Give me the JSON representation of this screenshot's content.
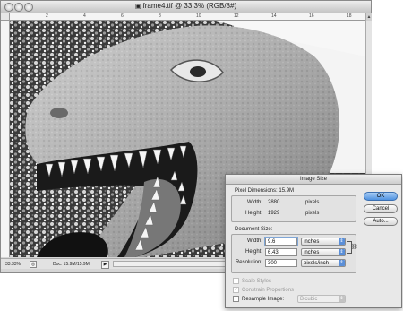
{
  "window": {
    "title": "frame4.tif @ 33.3% (RGB/8#)",
    "ruler_ticks": [
      "2",
      "4",
      "6",
      "8",
      "10",
      "12",
      "14",
      "16",
      "18"
    ]
  },
  "status": {
    "zoom": "33.33%",
    "doc_info": "Doc: 15.9M/15.9M"
  },
  "dialog": {
    "title": "Image Size",
    "pixel_dimensions": {
      "legend": "Pixel Dimensions:",
      "total": "15.9M",
      "width_label": "Width:",
      "width_value": "2880",
      "width_unit": "pixels",
      "height_label": "Height:",
      "height_value": "1929",
      "height_unit": "pixels"
    },
    "document_size": {
      "legend": "Document Size:",
      "width_label": "Width:",
      "width_value": "9.6",
      "width_unit": "inches",
      "height_label": "Height:",
      "height_value": "6.43",
      "height_unit": "inches",
      "resolution_label": "Resolution:",
      "resolution_value": "300",
      "resolution_unit": "pixels/inch"
    },
    "options": {
      "scale_styles": "Scale Styles",
      "constrain": "Constrain Proportions",
      "resample": "Resample Image:",
      "resample_method": "Bicubic"
    },
    "buttons": {
      "ok": "OK",
      "cancel": "Cancel",
      "auto": "Auto..."
    }
  },
  "colors": {
    "default_button": "#4f92e0",
    "dialog_bg": "#e8e8e8"
  }
}
